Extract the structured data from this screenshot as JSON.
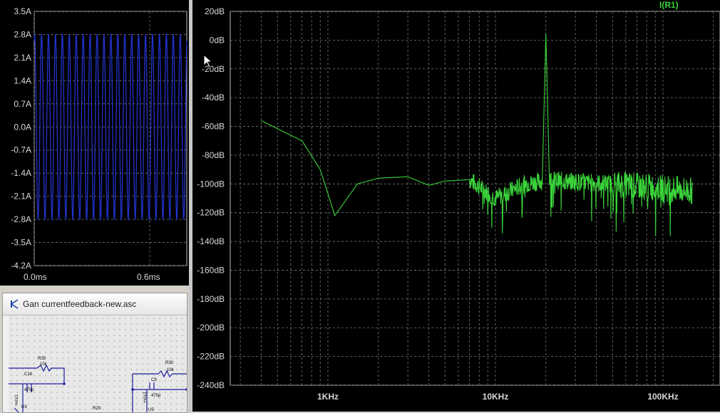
{
  "left_plot": {
    "y_ticks": [
      "3.5A",
      "2.8A",
      "2.1A",
      "1.4A",
      "0.7A",
      "0.0A",
      "-0.7A",
      "-1.4A",
      "-2.1A",
      "-2.8A",
      "-3.5A",
      "-4.2A"
    ],
    "x_ticks": [
      "0.0ms",
      "0.6ms"
    ],
    "trace_color": "#2233cc"
  },
  "right_plot": {
    "trace_label": "I(R1)",
    "y_ticks": [
      "20dB",
      "0dB",
      "-20dB",
      "-40dB",
      "-60dB",
      "-80dB",
      "-100dB",
      "-120dB",
      "-140dB",
      "-160dB",
      "-180dB",
      "-200dB",
      "-220dB",
      "-240dB"
    ],
    "x_ticks": [
      "1KHz",
      "10KHz",
      "100KHz"
    ],
    "trace_color": "#3ad33a"
  },
  "schematic": {
    "title": "Gan currentfeedback-new.asc",
    "components": [
      "R35",
      "10k",
      "C16",
      "470p",
      "U3",
      "R30",
      "10k",
      "C9",
      "470p",
      "R29",
      "U5",
      "+vcc1",
      "+vcc1"
    ]
  },
  "chart_data": [
    {
      "type": "line",
      "ylim": [
        -4.2,
        3.5
      ],
      "xlim_ticks": [
        "0.0ms",
        "0.6ms"
      ],
      "series": [
        {
          "values_description": "sinusoid",
          "amplitude": 2.8,
          "cycles_visible": 22
        }
      ],
      "grid": true
    },
    {
      "type": "line",
      "x_scale": "log",
      "x_ticks": [
        "1KHz",
        "10KHz",
        "100KHz"
      ],
      "ylim": [
        -240,
        20
      ],
      "series": [
        {
          "name": "I(R1)",
          "x": [
            400,
            700,
            900,
            1100,
            1500,
            2000,
            3000,
            4000,
            5000,
            7000,
            10000,
            15000,
            19000,
            20000,
            21000,
            25000,
            50000,
            100000,
            150000
          ],
          "y": [
            -56,
            -70,
            -90,
            -122,
            -100,
            -96,
            -95,
            -101,
            -98,
            -97,
            -110,
            -100,
            -98,
            5,
            -97,
            -98,
            -100,
            -103,
            -105
          ]
        }
      ],
      "grid": true
    }
  ]
}
